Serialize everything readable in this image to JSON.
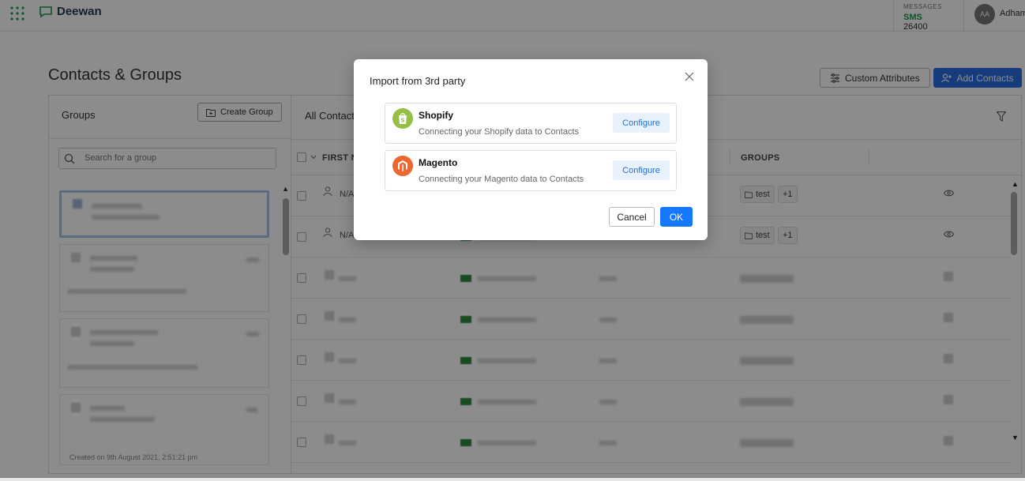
{
  "header": {
    "brand": "Deewan",
    "messages_label": "MESSAGES",
    "sms_label": "SMS",
    "sms_count": "26400",
    "avatar_initials": "AA",
    "user_name": "Adham"
  },
  "page": {
    "title": "Contacts & Groups",
    "custom_attributes_label": "Custom Attributes",
    "add_contacts_label": "Add Contacts"
  },
  "groups": {
    "title": "Groups",
    "create_label": "Create Group",
    "search_placeholder": "Search for a group",
    "last_card_footer": "Created on 9th August 2021, 2:51:21 pm"
  },
  "contacts": {
    "title": "All Contacts",
    "columns": [
      "FIRST NAME",
      "GROUPS"
    ],
    "rows": [
      {
        "name": "N/A",
        "tag": "test",
        "extra": "+1"
      },
      {
        "name": "N/A",
        "tag": "test",
        "extra": "+1"
      }
    ]
  },
  "modal": {
    "title": "Import from 3rd party",
    "integrations": [
      {
        "name": "Shopify",
        "description": "Connecting your Shopify data to Contacts",
        "action": "Configure",
        "color": "#95bf47"
      },
      {
        "name": "Magento",
        "description": "Connecting your Magento data to Contacts",
        "action": "Configure",
        "color": "#ee672f"
      }
    ],
    "cancel_label": "Cancel",
    "ok_label": "OK"
  }
}
